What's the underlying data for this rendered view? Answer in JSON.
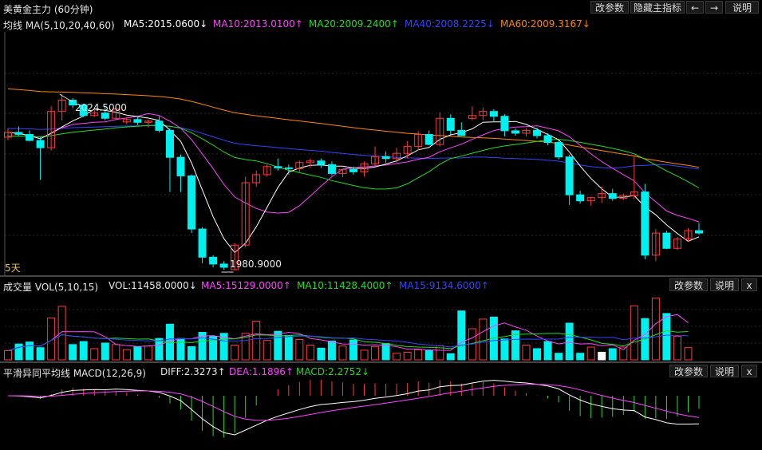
{
  "title": "美黄金主力 (60分钟)",
  "toolbar": {
    "edit_params": "改参数",
    "hide_indicator": "隐藏主指标",
    "prev": "←",
    "next": "→",
    "help": "说明"
  },
  "main": {
    "ma_label": "均线 MA(5,10,20,40,60)",
    "ma5": "MA5:2015.0600↓",
    "ma10": "MA10:2013.0100↑",
    "ma20": "MA20:2009.2400↑",
    "ma40": "MA40:2008.2225↓",
    "ma60": "MA60:2009.3167↓",
    "high_label": "2024.5000",
    "low_label": "1980.9000",
    "period_label": "5天"
  },
  "vol": {
    "label": "成交量 VOL(5,10,15)",
    "vol": "VOL:11458.0000↓",
    "ma5": "MA5:15129.0000↑",
    "ma10": "MA10:11428.4000↑",
    "ma15": "MA15:9134.6000↑",
    "edit": "改参数",
    "help": "说明",
    "close": "x"
  },
  "macd": {
    "label": "平滑异同平均线 MACD(12,26,9)",
    "diff": "DIFF:2.3273↑",
    "dea": "DEA:1.1896↑",
    "macd": "MACD:2.2752↓",
    "edit": "改参数",
    "help": "说明",
    "close": "x"
  },
  "colors": {
    "up": "#ff3b3b",
    "down": "#00f0f0",
    "ma5": "#ffffff",
    "ma10": "#ff44ff",
    "ma20": "#22dd22",
    "ma40": "#3344ff",
    "ma60": "#ff8800"
  },
  "chart_data": {
    "type": "candlestick",
    "ylim": [
      1980.9,
      2024.5
    ],
    "candles": [
      [
        2013.8,
        2016.0,
        2013.0,
        2015.0
      ],
      [
        2015.0,
        2016.5,
        2014.2,
        2014.5
      ],
      [
        2014.5,
        2015.5,
        2012.8,
        2013.0
      ],
      [
        2013.0,
        2013.8,
        2003.2,
        2011.2
      ],
      [
        2011.2,
        2021.5,
        2010.5,
        2020.2
      ],
      [
        2020.2,
        2024.5,
        2018.0,
        2023.0
      ],
      [
        2023.0,
        2023.5,
        2021.0,
        2021.8
      ],
      [
        2021.8,
        2022.0,
        2018.8,
        2019.2
      ],
      [
        2019.2,
        2020.5,
        2018.8,
        2019.8
      ],
      [
        2019.8,
        2021.5,
        2018.0,
        2018.5
      ],
      [
        2018.5,
        2021.0,
        2018.0,
        2020.8
      ],
      [
        2017.6,
        2018.8,
        2017.0,
        2018.2
      ],
      [
        2018.2,
        2019.0,
        2016.8,
        2017.5
      ],
      [
        2017.5,
        2018.2,
        2016.2,
        2017.8
      ],
      [
        2017.8,
        2019.0,
        2015.0,
        2015.5
      ],
      [
        2015.5,
        2016.0,
        2000.2,
        2008.8
      ],
      [
        2008.8,
        2009.5,
        2000.2,
        2004.2
      ],
      [
        2004.2,
        2004.6,
        1990.0,
        1991.0
      ],
      [
        1991.0,
        1991.5,
        1982.5,
        1984.0
      ],
      [
        1984.0,
        1984.5,
        1981.5,
        1982.3
      ],
      [
        1982.3,
        1983.0,
        1980.9,
        1981.5
      ],
      [
        1980.9,
        1987.5,
        1980.9,
        1987.0
      ],
      [
        1987.0,
        2004.0,
        1986.5,
        2002.5
      ],
      [
        2002.5,
        2005.5,
        2001.5,
        2004.5
      ],
      [
        2004.5,
        2007.0,
        2004.0,
        2006.5
      ],
      [
        2006.5,
        2008.5,
        2005.5,
        2006.2
      ],
      [
        2006.2,
        2007.0,
        2004.5,
        2006.0
      ],
      [
        2006.0,
        2008.0,
        2005.2,
        2007.5
      ],
      [
        2007.5,
        2008.5,
        2006.2,
        2007.9
      ],
      [
        2007.9,
        2008.5,
        2006.2,
        2007.0
      ],
      [
        2007.0,
        2007.8,
        2004.3,
        2004.8
      ],
      [
        2004.8,
        2006.0,
        2003.9,
        2005.8
      ],
      [
        2005.8,
        2006.5,
        2004.5,
        2005.2
      ],
      [
        2005.2,
        2007.8,
        2004.0,
        2007.2
      ],
      [
        2007.2,
        2011.5,
        2006.5,
        2009.0
      ],
      [
        2009.0,
        2010.3,
        2007.5,
        2008.5
      ],
      [
        2008.5,
        2011.2,
        2007.5,
        2009.8
      ],
      [
        2009.8,
        2012.8,
        2008.5,
        2011.5
      ],
      [
        2011.5,
        2015.3,
        2010.5,
        2014.5
      ],
      [
        2014.5,
        2015.5,
        2011.8,
        2012.0
      ],
      [
        2012.0,
        2020.0,
        2011.5,
        2018.5
      ],
      [
        2018.5,
        2019.5,
        2014.5,
        2015.5
      ],
      [
        2015.5,
        2017.5,
        2014.8,
        2014.2
      ],
      [
        2018.5,
        2021.5,
        2018.0,
        2019.2
      ],
      [
        2019.2,
        2021.2,
        2018.0,
        2020.2
      ],
      [
        2020.2,
        2020.8,
        2017.8,
        2019.0
      ],
      [
        2019.0,
        2019.5,
        2014.0,
        2015.4
      ],
      [
        2015.4,
        2016.0,
        2014.2,
        2014.8
      ],
      [
        2014.8,
        2016.0,
        2014.0,
        2015.5
      ],
      [
        2015.5,
        2016.2,
        2013.5,
        2014.2
      ],
      [
        2014.2,
        2014.8,
        2011.8,
        2012.5
      ],
      [
        2012.5,
        2013.0,
        2008.3,
        2008.9
      ],
      [
        2008.9,
        2009.5,
        1997.0,
        1999.5
      ],
      [
        1999.5,
        2000.5,
        1997.3,
        1998.0
      ],
      [
        1998.0,
        1999.0,
        1996.8,
        1998.8
      ],
      [
        1998.8,
        2001.5,
        1997.5,
        1999.8
      ],
      [
        1999.8,
        2001.0,
        1998.0,
        1998.6
      ],
      [
        1998.6,
        1999.8,
        1998.2,
        1999.3
      ],
      [
        1999.3,
        2009.0,
        1998.5,
        2000.2
      ],
      [
        2000.2,
        2002.2,
        1983.5,
        1984.5
      ],
      [
        1984.5,
        1991.0,
        1983.0,
        1990.0
      ],
      [
        1990.0,
        1990.6,
        1986.0,
        1986.2
      ],
      [
        1986.2,
        1989.0,
        1985.8,
        1988.5
      ],
      [
        1988.5,
        1991.2,
        1987.8,
        1990.6
      ],
      [
        1990.6,
        1992.5,
        1989.6,
        1990.0
      ]
    ],
    "volume": [
      1.8,
      3.1,
      3.5,
      2.4,
      8.2,
      10.5,
      3.0,
      3.6,
      2.2,
      3.3,
      3.0,
      2.0,
      2.6,
      2.7,
      4.2,
      7.0,
      4.2,
      2.6,
      5.4,
      4.6,
      5.2,
      2.9,
      5.2,
      7.6,
      3.8,
      5.6,
      4.8,
      4.0,
      2.9,
      2.3,
      3.7,
      2.7,
      3.9,
      1.9,
      2.6,
      3.2,
      1.3,
      1.5,
      2.0,
      1.8,
      2.8,
      1.2,
      9.6,
      6.1,
      8.0,
      8.4,
      4.1,
      5.7,
      2.9,
      2.2,
      3.6,
      1.3,
      7.2,
      1.3,
      2.5,
      1.5,
      2.2,
      2.5,
      10.6,
      8.1,
      12.1,
      9.1,
      4.6,
      2.4
    ],
    "vol_ylim": [
      0,
      13
    ]
  }
}
